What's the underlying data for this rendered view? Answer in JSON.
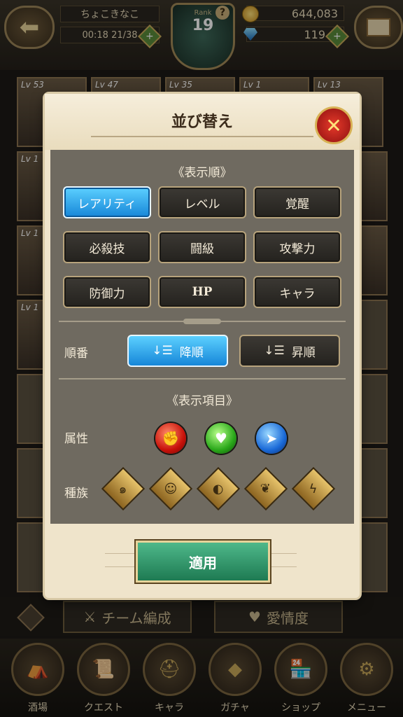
{
  "header": {
    "player_name": "ちょこきなこ",
    "stamina_timer": "00:18 21/38",
    "rank_label": "Rank",
    "rank": "19",
    "gold": "644,083",
    "gems": "119"
  },
  "background_cards": [
    {
      "lv": "Lv 53"
    },
    {
      "lv": "Lv 47"
    },
    {
      "lv": "Lv 35"
    },
    {
      "lv": "Lv 1"
    },
    {
      "lv": "Lv 13"
    },
    {
      "lv": "Lv 1"
    },
    {
      "lv": "Lv 1"
    },
    {
      "lv": "Lv 1"
    }
  ],
  "modal": {
    "title": "並び替え",
    "display_order_title": "《表示順》",
    "sort_buttons": [
      {
        "label": "レアリティ",
        "active": true
      },
      {
        "label": "レベル",
        "active": false
      },
      {
        "label": "覚醒",
        "active": false
      },
      {
        "label": "必殺技",
        "active": false
      },
      {
        "label": "闘級",
        "active": false
      },
      {
        "label": "攻撃力",
        "active": false
      },
      {
        "label": "防御力",
        "active": false
      },
      {
        "label": "HP",
        "active": false
      },
      {
        "label": "キャラ",
        "active": false
      }
    ],
    "order_label": "順番",
    "descending": "降順",
    "ascending": "昇順",
    "display_items_title": "《表示項目》",
    "attribute_label": "属性",
    "race_label": "種族",
    "apply": "適用"
  },
  "subbar": {
    "team_edit": "チーム編成",
    "affection": "愛情度"
  },
  "nav": {
    "tavern": "酒場",
    "quest": "クエスト",
    "character": "キャラ",
    "gacha": "ガチャ",
    "shop": "ショップ",
    "menu": "メニュー"
  },
  "colors": {
    "active_button": "#1686d8",
    "apply_button": "#1e7a52",
    "close_button": "#c8120a"
  },
  "icons": {
    "attributes": [
      "strength-icon",
      "hp-icon",
      "speed-icon"
    ],
    "races": [
      "demon-icon",
      "human-icon",
      "giant-icon",
      "fairy-icon",
      "goddess-icon"
    ]
  }
}
